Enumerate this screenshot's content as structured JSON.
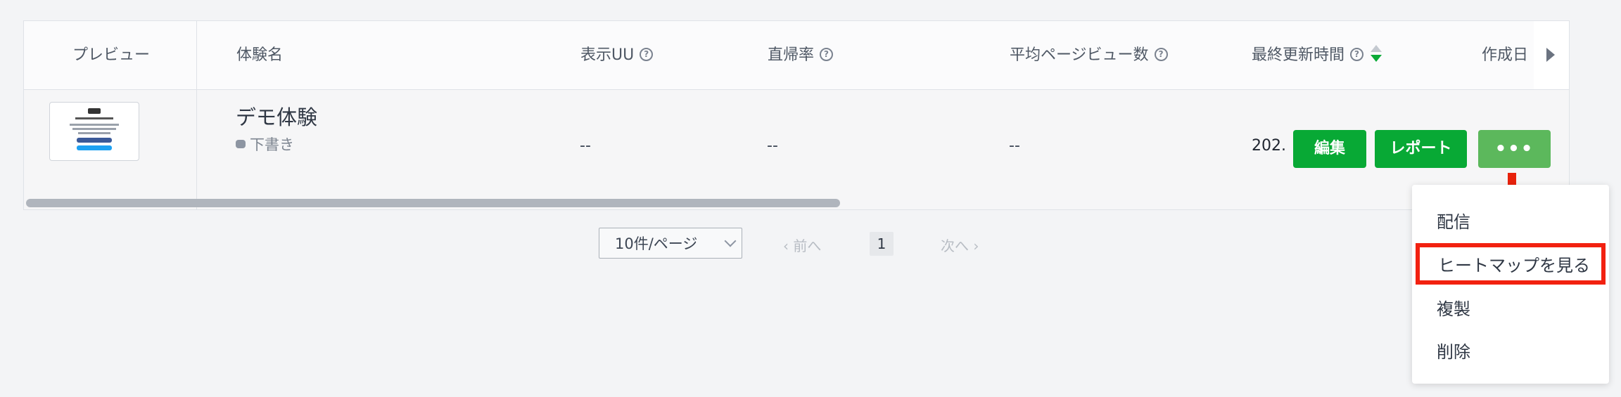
{
  "table": {
    "headers": {
      "preview": "プレビュー",
      "name": "体験名",
      "uu": "表示UU",
      "bounce": "直帰率",
      "avg_pv": "平均ページビュー数",
      "last_updated": "最終更新時間",
      "created": "作成日"
    },
    "help_glyph": "?",
    "rows": [
      {
        "name": "デモ体験",
        "status": "下書き",
        "uu": "--",
        "bounce": "--",
        "avg_pv": "--",
        "date_truncated": "202.",
        "edit_label": "編集",
        "report_label": "レポート",
        "more_label": "•••"
      }
    ]
  },
  "pagination": {
    "page_size": "10件/ページ",
    "prev": "‹ 前へ",
    "current": "1",
    "next": "次へ ›"
  },
  "dropdown": {
    "items": [
      "配信",
      "ヒートマップを見る",
      "複製",
      "削除"
    ]
  },
  "colors": {
    "primary_green": "#08a935",
    "annotation_red": "#e8220c"
  }
}
